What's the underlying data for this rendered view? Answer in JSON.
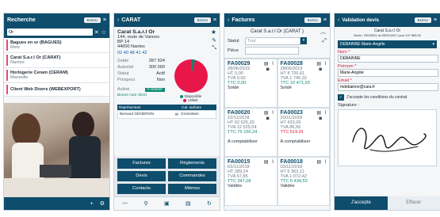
{
  "s1": {
    "title": "Recherche",
    "dropdown": "BIJOU",
    "search_value": "Or",
    "results": [
      {
        "name": "Bagues en or (BAGUES)",
        "city": "Metz"
      },
      {
        "name": "Carat S.a.r.l Or (CARAT)",
        "city": "Nantes"
      },
      {
        "name": "Horlogerie Ceram (CERAM)",
        "city": "Marseille"
      },
      {
        "name": "Client Web Divers (WEBEXPORT)",
        "city": ""
      }
    ],
    "accent": "#e04e74"
  },
  "s2": {
    "title": "CARAT",
    "dropdown": "BIJOU",
    "company": "Carat S.a.r.l Or",
    "address1": "144, route de Vannes",
    "address2": "BP 14",
    "address3": "44000 Nantes",
    "phone": "02 40 48 41 42",
    "stats": [
      {
        "label": "Solde",
        "value": "287 924"
      },
      {
        "label": "Autorisé",
        "value": "300 000"
      },
      {
        "label": "Statut",
        "value": "Actif"
      },
      {
        "label": "Prospect",
        "value": "Non"
      }
    ],
    "action_label": "Action",
    "action_value": "A classer",
    "bonne_cote": "Bonne cote client",
    "table_headers": [
      "Représentant",
      "Cat. tarifaire"
    ],
    "table_values": [
      "Bernard GENDRON",
      "Grossistes"
    ],
    "pie": {
      "disponible": 0.04,
      "utilise": 0.96
    },
    "legend": [
      "Disponible",
      "Utilisé"
    ],
    "buttons": [
      "Factures",
      "Règlements",
      "Devis",
      "Commandes",
      "Contacts",
      "Mémos"
    ]
  },
  "s3": {
    "title": "Factures",
    "dropdown": "BIJOU",
    "subtitle": "Carat S.a.r.l Or (CARAT )",
    "statut_label": "Statut",
    "statut_value": "Tout",
    "piece_label": "Pièce",
    "invoices": [
      {
        "num": "FA00029",
        "date": "28/06/2019",
        "ht": "HT 0,00",
        "tva": "TVA 0,00",
        "ttc": "TTC 0,00",
        "status": "Soldé"
      },
      {
        "num": "FA00028",
        "date": "28/06/2019",
        "ht": "HT 8 726,61",
        "tva": "TVA 1 745,32",
        "ttc": "TTC 10 471,93",
        "status": "Soldé"
      },
      {
        "num": "FA00020",
        "date": "22/11/2018",
        "ht": "HT 62 625,20",
        "tva": "TVA 12 525,04",
        "ttc": "TTC 75 150,24",
        "status": "A comptabiliser"
      },
      {
        "num": "FA00023",
        "date": "20/11/2018",
        "ht": "HT 433,26",
        "tva": "TVA 86,65",
        "ttc": "TTC 519,91",
        "status": "A comptabiliser"
      },
      {
        "num": "FA00015",
        "date": "03/11/2018",
        "ht": "HT 289,24",
        "tva": "TVA 57,85",
        "ttc": "TTC 347,09",
        "status": "Validée"
      },
      {
        "num": "FA00018",
        "date": "03/11/2018",
        "ht": "HT 5 362,11",
        "tva": "TVA 1 072,42",
        "ttc": "TTC 6 434,53",
        "status": "Validée"
      }
    ]
  },
  "s4": {
    "title": "Validation devis",
    "dropdown": "BIJOU",
    "subtitle1": "Carat S.a.r.l Or",
    "subtitle2": "Devis : DE00001 du 05/01/2017 pour 197 865,00",
    "select_value": "DEBAINNE Marie-Angèle",
    "nom_label": "Nom *",
    "nom_value": "DEBAINNE",
    "prenom_label": "Prénom *",
    "prenom_value": "Marie-Angèle",
    "email_label": "Email *",
    "email_value": "mdebainne@cara.fr",
    "accept_label": "J'accepte les conditions du contrat",
    "signature_label": "Signature :",
    "accept_btn": "J'accepte",
    "clear_btn": "Effacer"
  }
}
